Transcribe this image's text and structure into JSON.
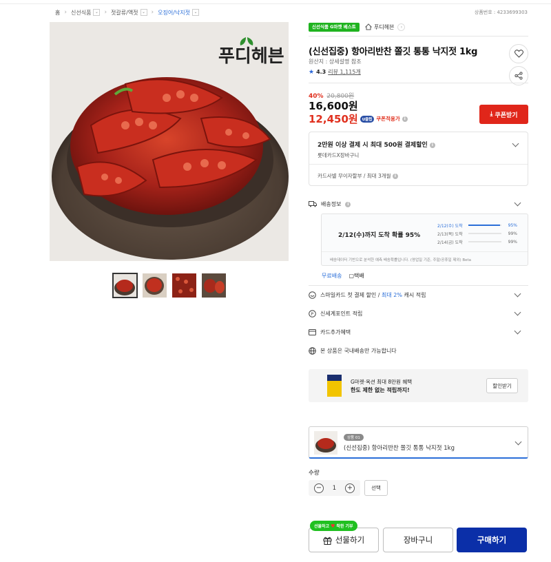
{
  "breadcrumb": {
    "home": "홈",
    "items": [
      "신선식품",
      "젓갈류/액젓",
      "오징어/낙지젓"
    ]
  },
  "product_no": "상품번호 : 4233699303",
  "hero": {
    "brand_logo": "푸디헤븐"
  },
  "seller": {
    "badge": "신선식품 G마켓 베스트",
    "shop_name": "푸디헤븐"
  },
  "product": {
    "title": "(신선집중) 항아리반찬 쫄깃 통통 낙지젓 1kg",
    "origin": "원산지 : 상세설명 참조",
    "rating": "4.3",
    "review": "리뷰 1,115개"
  },
  "pricing": {
    "discount_pct": "40%",
    "original_price": "20,800원",
    "price": "16,600원",
    "coupon_price": "12,450원",
    "u_badge": "U클럽",
    "coupon_note": "쿠폰적용가",
    "coupon_button": "쿠폰받기"
  },
  "card_offer": {
    "title": "2만원 이상 결제 시 최대 500원 결제할인",
    "sub": "롯데카드X장바구니",
    "installment": "카드사별 무이자할부 / 최대 3개월"
  },
  "shipping": {
    "label": "배송정보",
    "main": "2/12(수)까지 도착 확률 95%",
    "bars": [
      {
        "date": "2/12(수) 도착",
        "pct": "95%",
        "fill": 0.95
      },
      {
        "date": "2/13(목) 도착",
        "pct": "99%",
        "fill": 0.99
      },
      {
        "date": "2/14(금) 도착",
        "pct": "99%",
        "fill": 0.99
      }
    ],
    "note": "배송데이터 기반으로 분석한 예측 배송확률입니다. (영업일 기준, 주말/공휴일 제외) Beta",
    "free": "무료배송",
    "courier": "택배"
  },
  "rows": {
    "smile": [
      "스마일카드 첫 결제 할인 / ",
      "최대 2%",
      " 캐시 적립"
    ],
    "shinsegae": "신세계포인트 적립",
    "card_extra": "카드추가혜택",
    "domestic": "본 상품은 국내배송만 가능합니다"
  },
  "banner": {
    "line1": "G마켓·옥션 최대 8만원 혜택",
    "line2": "한도 제한 없는 적립까지!",
    "button": "할인받기"
  },
  "option": {
    "tag": "상품 01",
    "name": "(신선집중) 항아리반찬 쫄깃 통통 낙지젓 1kg"
  },
  "quantity": {
    "label": "수량",
    "value": "1",
    "select": "선택"
  },
  "actions": {
    "gift_bubble_pre": "선물하고",
    "gift_bubble_post": "착한 기부",
    "gift": "선물하기",
    "cart": "장바구니",
    "buy": "구매하기"
  },
  "colors": {
    "accent_red": "#e0261a",
    "buy_blue": "#0b2fa8",
    "link_blue": "#2a6ed8",
    "badge_green": "#1fb31f"
  }
}
